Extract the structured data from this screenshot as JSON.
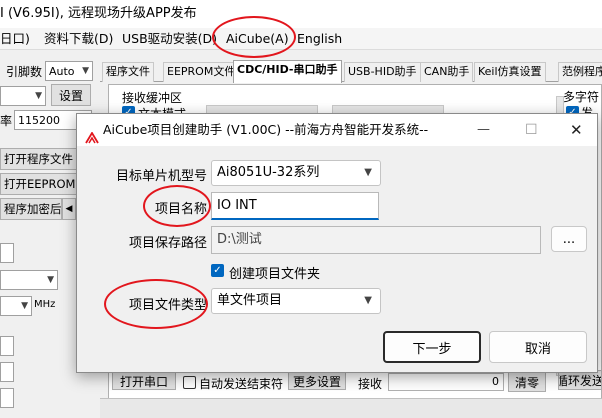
{
  "window": {
    "title": "I (V6.95I), 远程现场升级APP发布"
  },
  "menu": {
    "items": [
      "日口)",
      "资料下载(D)",
      "USB驱动安装(D)",
      "AiCube(A)",
      "English"
    ]
  },
  "left_panel": {
    "pin_label": "引脚数",
    "pin_value": "Auto",
    "settings_label": "设置",
    "baud_label": "率",
    "baud_value": "115200",
    "open_program_label": "打开程序文件",
    "open_eeprom_label": "打开EEPROM文件",
    "encrypt_label": "程序加密后",
    "mhz_label": "MHz"
  },
  "tabs": [
    "程序文件",
    "EEPROM文件",
    "CDC/HID-串口助手",
    "USB-HID助手",
    "CAN助手",
    "Keil仿真设置",
    "范例程序"
  ],
  "main": {
    "recv_buffer_label": "接收缓冲区",
    "text_mode_label": "文本模式",
    "multi_string_label": "多字符",
    "send_label": "发送",
    "open_port_label": "打开串口",
    "auto_send_label": "自动发送结束符",
    "more_settings_label": "更多设置",
    "recv_label": "接收",
    "recv_count": "0",
    "clear_label": "清零",
    "loop_send_label": "循环发送"
  },
  "dialog": {
    "title": "AiCube项目创建助手 (V1.00C) --前海方舟智能开发系统--",
    "model_label": "目标单片机型号",
    "model_value": "Ai8051U-32系列",
    "name_label": "项目名称",
    "name_value": "IO INT",
    "path_label": "项目保存路径",
    "path_value": "D:\\测试",
    "browse_label": "...",
    "create_folder_label": "创建项目文件夹",
    "type_label": "项目文件类型",
    "type_value": "单文件项目",
    "next_label": "下一步",
    "cancel_label": "取消",
    "minimize_icon": "—",
    "maximize_icon": "☐",
    "close_icon": "✕"
  },
  "colors": {
    "highlight": "#e2161d",
    "accent": "#0067c0"
  }
}
